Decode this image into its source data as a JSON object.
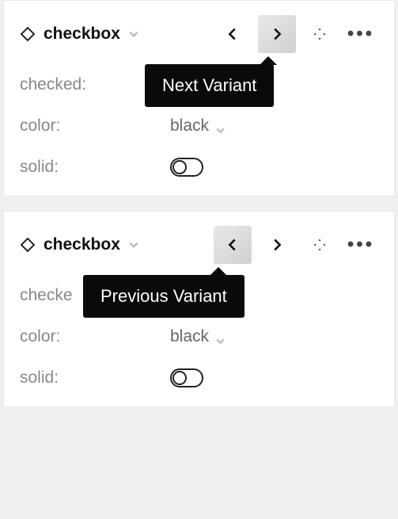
{
  "panels": [
    {
      "component_name": "checkbox",
      "highlighted_nav": "next",
      "tooltip": "Next Variant",
      "props": {
        "checked_label": "checked:",
        "checked_value": "",
        "color_label": "color:",
        "color_value": "black",
        "solid_label": "solid:",
        "solid_value": false
      }
    },
    {
      "component_name": "checkbox",
      "highlighted_nav": "prev",
      "tooltip": "Previous Variant",
      "props": {
        "checked_label": "checke",
        "checked_value": "",
        "color_label": "color:",
        "color_value": "black",
        "solid_label": "solid:",
        "solid_value": false
      }
    }
  ]
}
